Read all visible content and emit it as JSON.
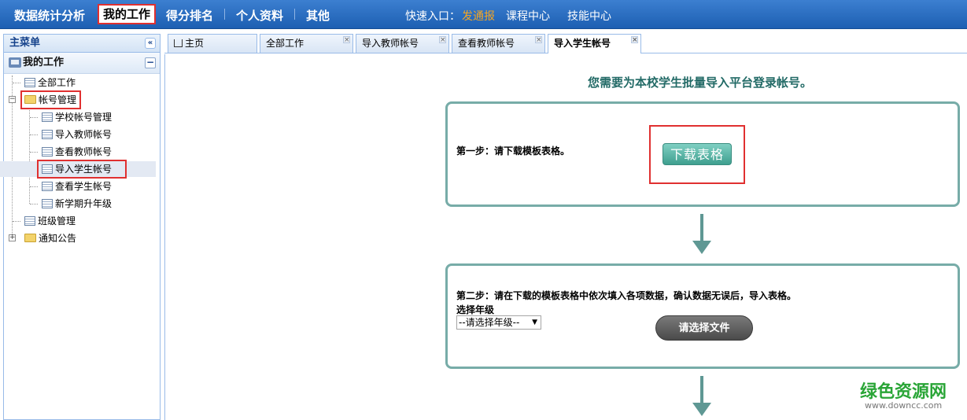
{
  "topnav": {
    "items": [
      "数据统计分析",
      "我的工作",
      "得分排名",
      "个人资料",
      "其他"
    ],
    "quick_label": "快速入口：",
    "quick_links": [
      "发通报",
      "课程中心",
      "技能中心"
    ]
  },
  "sidebar": {
    "title": "主菜单",
    "collapse_glyph": "«",
    "group_title": "我的工作",
    "group_toggle": "−",
    "items": {
      "all_work": "全部工作",
      "account_mgmt": "帐号管理",
      "school_accounts": "学校帐号管理",
      "import_teacher": "导入教师帐号",
      "view_teacher": "查看教师帐号",
      "import_student": "导入学生帐号",
      "view_student": "查看学生帐号",
      "promote_grade": "新学期升年级",
      "class_mgmt": "班级管理",
      "notices": "通知公告"
    }
  },
  "tabs": [
    {
      "label": "主页"
    },
    {
      "label": "全部工作"
    },
    {
      "label": "导入教师帐号"
    },
    {
      "label": "查看教师帐号"
    },
    {
      "label": "导入学生帐号"
    }
  ],
  "main": {
    "title": "您需要为本校学生批量导入平台登录帐号。",
    "step1_text": "第一步：请下载模板表格。",
    "download_button": "下载表格",
    "step2_text": "第二步：请在下载的模板表格中依次填入各项数据，确认数据无误后，导入表格。",
    "grade_label": "选择年级",
    "grade_select_value": "--请选择年级--",
    "file_button": "请选择文件"
  },
  "watermark": {
    "text": "绿色资源网",
    "url": "www.downcc.com"
  },
  "colors": {
    "nav": "#2a6cc2",
    "accent": "#77aca8",
    "highlight": "#e03030"
  }
}
